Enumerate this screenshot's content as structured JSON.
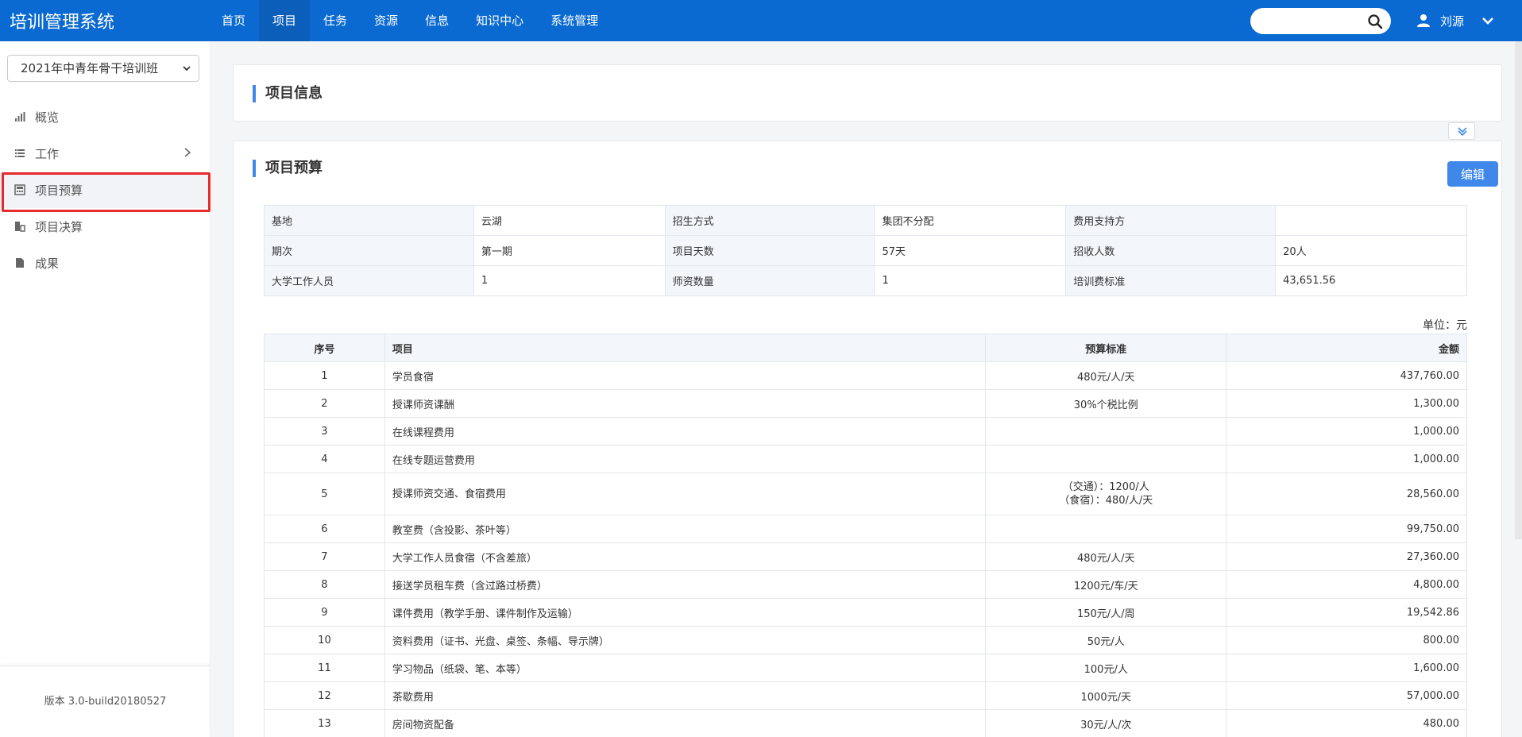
{
  "header": {
    "app_title": "培训管理系统",
    "nav": [
      "首页",
      "项目",
      "任务",
      "资源",
      "信息",
      "知识中心",
      "系统管理"
    ],
    "active_nav": 1,
    "search_placeholder": "",
    "user_name": "刘源",
    "brand_color": "#0a6ad1"
  },
  "sidebar": {
    "project_select": "2021年中青年骨干培训班",
    "items": [
      {
        "label": "概览",
        "icon": "bar-chart-icon"
      },
      {
        "label": "工作",
        "icon": "list-icon"
      },
      {
        "label": "项目预算",
        "icon": "calculator-icon"
      },
      {
        "label": "项目决算",
        "icon": "report-icon"
      },
      {
        "label": "成果",
        "icon": "file-icon"
      }
    ],
    "active_item": 2,
    "version": "版本 3.0-build20180527"
  },
  "main": {
    "info_panel_title": "项目信息",
    "budget_panel_title": "项目预算",
    "edit_label": "编辑",
    "unit_label": "单位：元",
    "info_rows": [
      [
        {
          "k": "基地",
          "v": "云湖"
        },
        {
          "k": "招生方式",
          "v": "集团不分配"
        },
        {
          "k": "费用支持方",
          "v": ""
        }
      ],
      [
        {
          "k": "期次",
          "v": "第一期"
        },
        {
          "k": "项目天数",
          "v": "57天"
        },
        {
          "k": "招收人数",
          "v": "20人"
        }
      ],
      [
        {
          "k": "大学工作人员",
          "v": "1"
        },
        {
          "k": "师资数量",
          "v": "1"
        },
        {
          "k": "培训费标准",
          "v": "43,651.56"
        }
      ]
    ],
    "table_headers": [
      "序号",
      "项目",
      "预算标准",
      "金额"
    ],
    "rows": [
      {
        "no": "1",
        "item": "学员食宿",
        "std": "480元/人/天",
        "amount": "437,760.00"
      },
      {
        "no": "2",
        "item": "授课师资课酬",
        "std": "30%个税比例",
        "amount": "1,300.00"
      },
      {
        "no": "3",
        "item": "在线课程费用",
        "std": "",
        "amount": "1,000.00"
      },
      {
        "no": "4",
        "item": "在线专题运营费用",
        "std": "",
        "amount": "1,000.00"
      },
      {
        "no": "5",
        "item": "授课师资交通、食宿费用",
        "std": "（交通）：1200/人",
        "std2": "（食宿）：480/人/天",
        "amount": "28,560.00"
      },
      {
        "no": "6",
        "item": "教室费（含投影、茶叶等）",
        "std": "",
        "amount": "99,750.00"
      },
      {
        "no": "7",
        "item": "大学工作人员食宿（不含差旅）",
        "std": "480元/人/天",
        "amount": "27,360.00"
      },
      {
        "no": "8",
        "item": "接送学员租车费（含过路过桥费）",
        "std": "1200元/车/天",
        "amount": "4,800.00"
      },
      {
        "no": "9",
        "item": "课件费用（教学手册、课件制作及运输）",
        "std": "150元/人/周",
        "amount": "19,542.86"
      },
      {
        "no": "10",
        "item": "资料费用（证书、光盘、桌签、条幅、导示牌）",
        "std": "50元/人",
        "amount": "800.00"
      },
      {
        "no": "11",
        "item": "学习物品（纸袋、笔、本等）",
        "std": "100元/人",
        "amount": "1,600.00"
      },
      {
        "no": "12",
        "item": "茶歇费用",
        "std": "1000元/天",
        "amount": "57,000.00"
      },
      {
        "no": "13",
        "item": "房间物资配备",
        "std": "30元/人/次",
        "amount": "480.00"
      },
      {
        "no": "",
        "item": "",
        "std": "",
        "amount": ""
      }
    ]
  }
}
